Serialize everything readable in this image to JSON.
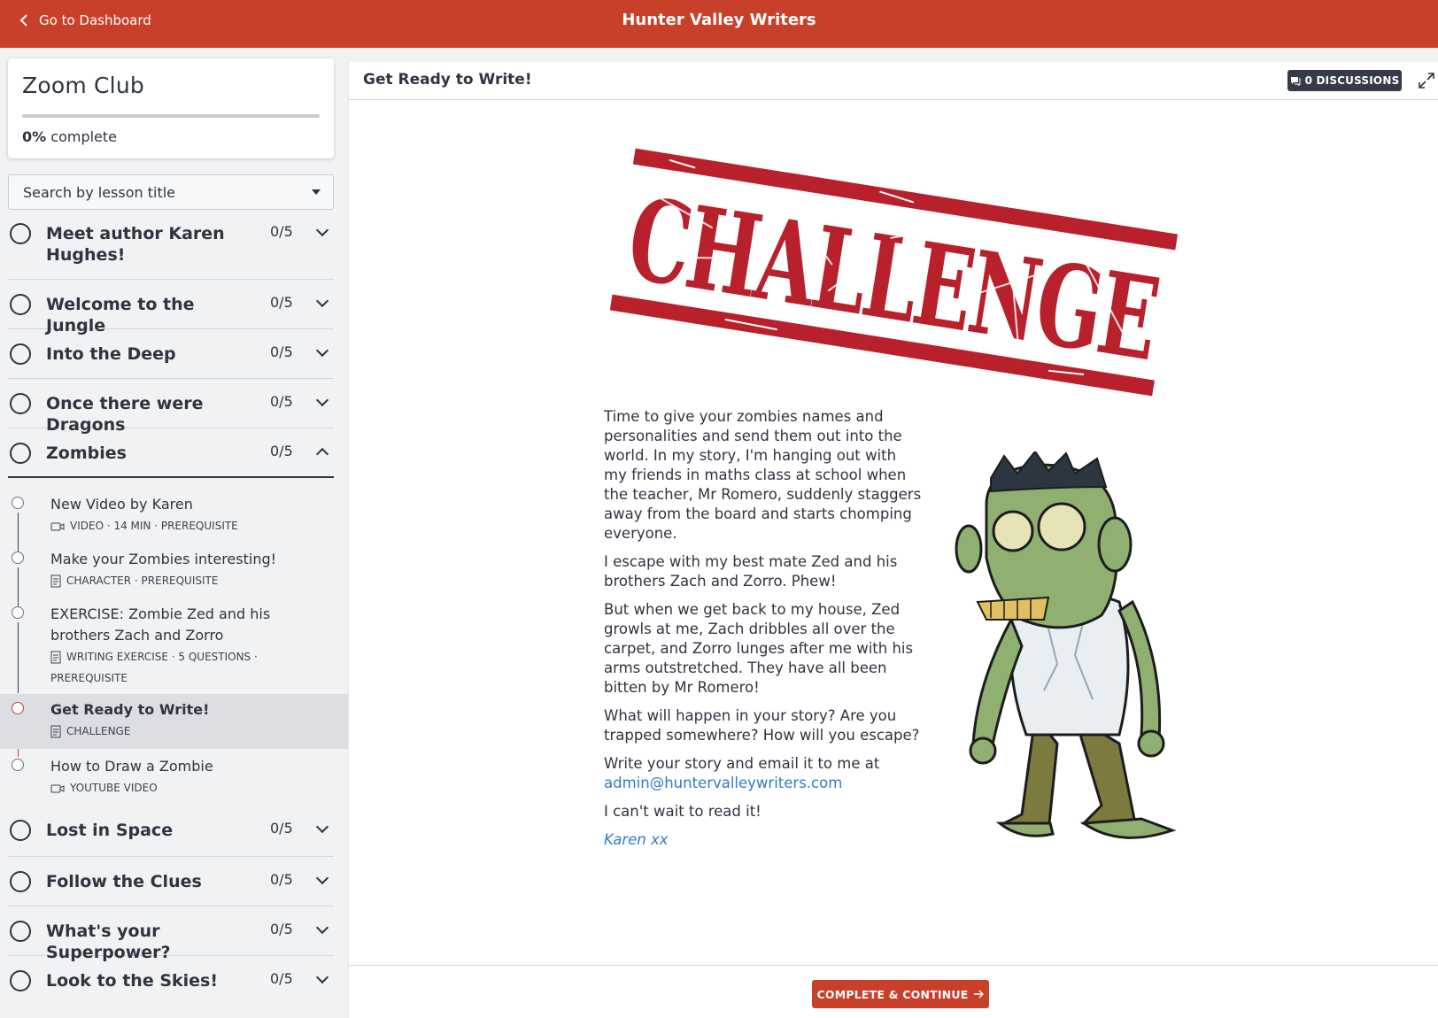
{
  "header": {
    "back_label": "Go to Dashboard",
    "site_title": "Hunter Valley Writers",
    "bar_color": "#c9402a"
  },
  "course": {
    "title": "Zoom Club",
    "progress_value": "0%",
    "progress_suffix": "complete",
    "progress_fraction": 0
  },
  "search": {
    "placeholder": "Search by lesson title"
  },
  "modules": [
    {
      "title": "Meet author Karen Hughes!",
      "count": "0/5",
      "expanded": false
    },
    {
      "title": "Welcome to the Jungle",
      "count": "0/5",
      "expanded": false
    },
    {
      "title": "Into the Deep",
      "count": "0/5",
      "expanded": false
    },
    {
      "title": "Once there were Dragons",
      "count": "0/5",
      "expanded": false
    },
    {
      "title": "Zombies",
      "count": "0/5",
      "expanded": true
    },
    {
      "title": "Lost in Space",
      "count": "0/5",
      "expanded": false
    },
    {
      "title": "Follow the Clues",
      "count": "0/5",
      "expanded": false
    },
    {
      "title": "What's your Superpower?",
      "count": "0/5",
      "expanded": false
    },
    {
      "title": "Look to the Skies!",
      "count": "0/5",
      "expanded": false
    }
  ],
  "lessons": [
    {
      "title": "New Video by Karen",
      "meta": "VIDEO · 14 MIN · PREREQUISITE",
      "icon": "video-icon",
      "active": false
    },
    {
      "title": "Make your Zombies interesting!",
      "meta": "CHARACTER · PREREQUISITE",
      "icon": "document-icon",
      "active": false
    },
    {
      "title": "EXERCISE: Zombie Zed and his brothers Zach and Zorro",
      "meta": "WRITING EXERCISE · 5 QUESTIONS · PREREQUISITE",
      "icon": "document-icon",
      "active": false
    },
    {
      "title": "Get Ready to Write!",
      "meta": "CHALLENGE",
      "icon": "document-icon",
      "active": true
    },
    {
      "title": "How to Draw a Zombie",
      "meta": "YOUTUBE VIDEO",
      "icon": "video-icon",
      "active": false
    }
  ],
  "main": {
    "lesson_title": "Get Ready to Write!",
    "discussions_label": "0 DISCUSSIONS",
    "challenge_stamp": "CHALLENGE",
    "paragraphs": [
      "Time to give your zombies names and personalities and send them out into the world. In my story, I'm hanging out with my friends in maths class at school when the teacher, Mr Romero, suddenly staggers away from the board and starts chomping everyone.",
      "I escape with my best mate Zed and his brothers Zach and Zorro. Phew!",
      "But when we get back to my house, Zed growls at me, Zach dribbles all over the carpet, and Zorro lunges after me with his arms outstretched. They have all been bitten by Mr Romero!",
      "What will happen in your story? Are you trapped somewhere? How will you escape?",
      "Write your story and email it to me at"
    ],
    "email": "admin@huntervalleywriters.com",
    "closing": "I can't wait to read it!",
    "signature": "Karen xx",
    "complete_label": "COMPLETE & CONTINUE",
    "accent_color": "#c9402a",
    "link_color": "#2f7cc7"
  }
}
